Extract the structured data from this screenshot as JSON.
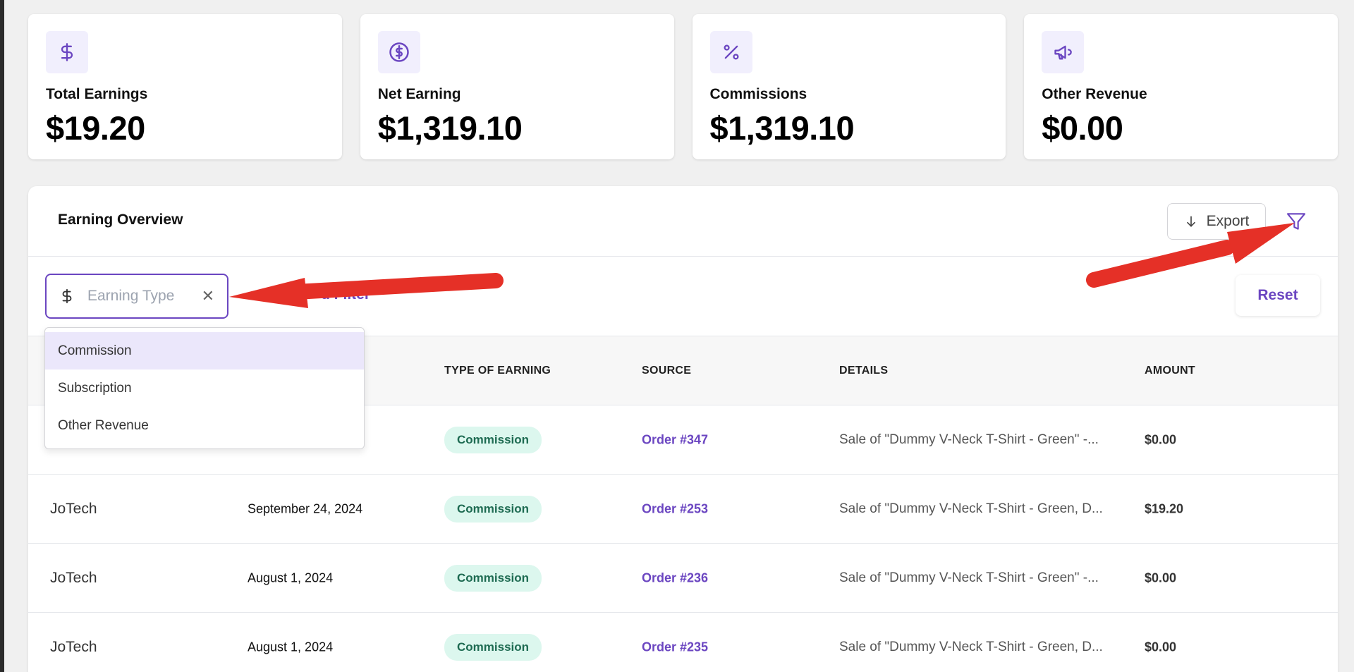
{
  "stats": [
    {
      "label": "Total Earnings",
      "value": "$19.20",
      "icon": "dollar-sign-icon"
    },
    {
      "label": "Net Earning",
      "value": "$1,319.10",
      "icon": "dollar-circle-icon"
    },
    {
      "label": "Commissions",
      "value": "$1,319.10",
      "icon": "percent-icon"
    },
    {
      "label": "Other Revenue",
      "value": "$0.00",
      "icon": "megaphone-icon"
    }
  ],
  "panel": {
    "title": "Earning Overview",
    "export_label": "Export"
  },
  "filters": {
    "earning_type_placeholder": "Earning Type",
    "add_filter_label": "d Filter",
    "reset_label": "Reset",
    "dropdown_options": [
      "Commission",
      "Subscription",
      "Other Revenue"
    ],
    "highlighted_option": "Commission"
  },
  "table": {
    "columns": [
      "TYPE OF EARNING",
      "SOURCE",
      "DETAILS",
      "AMOUNT"
    ],
    "rows": [
      {
        "vendor": "",
        "date": "",
        "type": "Commission",
        "source": "Order #347",
        "details": "Sale of \"Dummy V-Neck T-Shirt - Green\" -...",
        "amount": "$0.00"
      },
      {
        "vendor": "JoTech",
        "date": "September 24, 2024",
        "type": "Commission",
        "source": "Order #253",
        "details": "Sale of \"Dummy V-Neck T-Shirt - Green, D...",
        "amount": "$19.20"
      },
      {
        "vendor": "JoTech",
        "date": "August 1, 2024",
        "type": "Commission",
        "source": "Order #236",
        "details": "Sale of \"Dummy V-Neck T-Shirt - Green\" -...",
        "amount": "$0.00"
      },
      {
        "vendor": "JoTech",
        "date": "August 1, 2024",
        "type": "Commission",
        "source": "Order #235",
        "details": "Sale of \"Dummy V-Neck T-Shirt - Green, D...",
        "amount": "$0.00"
      }
    ]
  },
  "colors": {
    "accent": "#6b46c1",
    "annotation_arrow": "#e53027",
    "badge_bg": "#dcf7ee",
    "badge_text": "#1e6b52"
  }
}
